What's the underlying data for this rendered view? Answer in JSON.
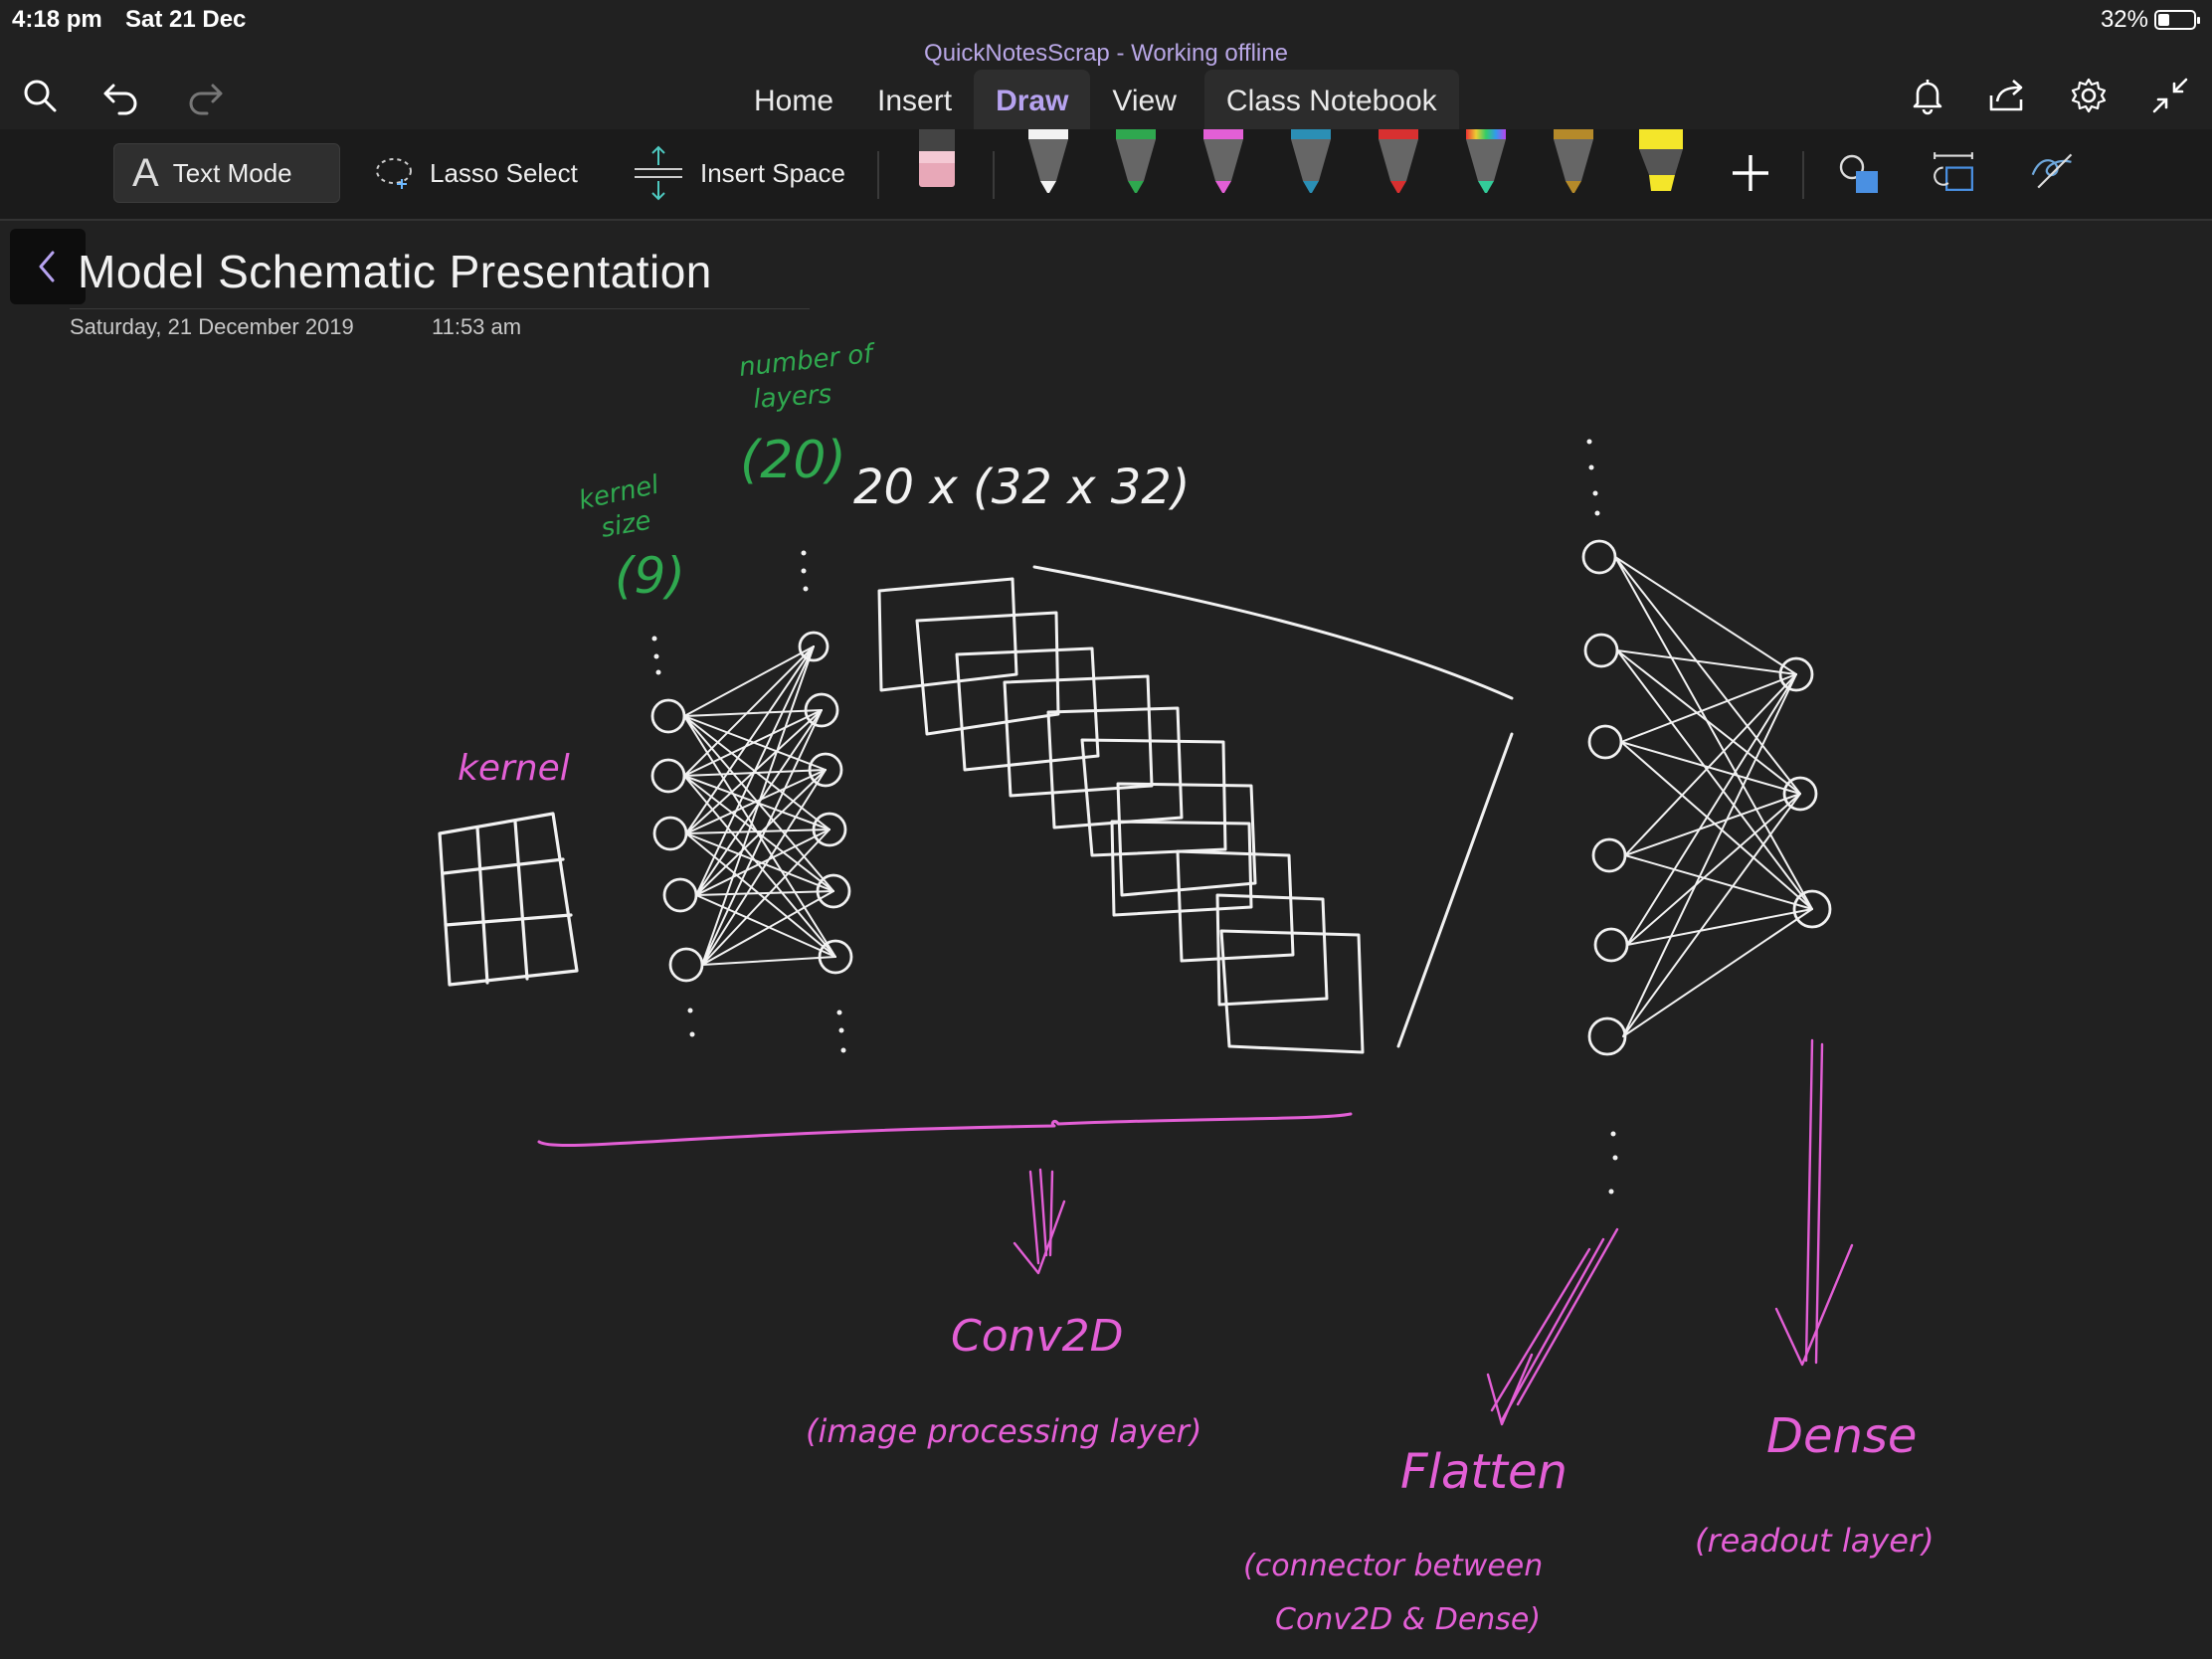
{
  "status": {
    "time": "4:18 pm",
    "date": "Sat 21 Dec",
    "battery": "32%",
    "battery_level_pct": 32
  },
  "app": {
    "title": "QuickNotesScrap - Working offline"
  },
  "topbar": {
    "icons": [
      "search-icon",
      "undo-icon",
      "redo-icon",
      "bell-icon",
      "share-icon",
      "gear-icon",
      "collapse-icon"
    ],
    "tabs": [
      {
        "label": "Home",
        "active": false
      },
      {
        "label": "Insert",
        "active": false
      },
      {
        "label": "Draw",
        "active": true
      },
      {
        "label": "View",
        "active": false
      },
      {
        "label": "Class Notebook",
        "active": false
      }
    ]
  },
  "toolbar": {
    "text_mode": "Text Mode",
    "lasso_select": "Lasso Select",
    "insert_space": "Insert Space",
    "pens": [
      {
        "name": "eraser",
        "color": "#e8a8b8"
      },
      {
        "name": "pen-white",
        "color": "#f2f2f2"
      },
      {
        "name": "pen-green",
        "color": "#2fa84f"
      },
      {
        "name": "pen-pink",
        "color": "#e35fd6"
      },
      {
        "name": "pen-teal",
        "color": "#2b8fb5"
      },
      {
        "name": "pen-red",
        "color": "#d83030"
      },
      {
        "name": "pen-rainbow",
        "color": "#e0a040"
      },
      {
        "name": "pen-gold",
        "color": "#b58a2a"
      },
      {
        "name": "highlighter-yellow",
        "color": "#f4e62a"
      }
    ],
    "add_pen": "+",
    "extra_icons": [
      "shapes-icon",
      "ink-to-shape-icon",
      "ink-replay-icon"
    ]
  },
  "page": {
    "title": "Model Schematic Presentation",
    "date": "Saturday, 21 December 2019",
    "time": "11:53 am"
  },
  "annotations": {
    "number_of_layers_1": "number of",
    "number_of_layers_2": "layers",
    "layers_value": "(20)",
    "kernel_size_1": "kernel",
    "kernel_size_2": "size",
    "kernel_size_value": "(9)",
    "dims": "20 x (32 x 32)",
    "kernel": "kernel",
    "conv2d": "Conv2D",
    "conv2d_desc": "(image processing layer)",
    "flatten": "Flatten",
    "flatten_desc_1": "(connector between",
    "flatten_desc_2": "Conv2D & Dense)",
    "dense": "Dense",
    "dense_desc": "(readout layer)"
  },
  "colors": {
    "ink_white": "#f2f2f2",
    "ink_green": "#2fa84f",
    "ink_pink": "#e35fd6",
    "accent": "#b7a3f0"
  }
}
